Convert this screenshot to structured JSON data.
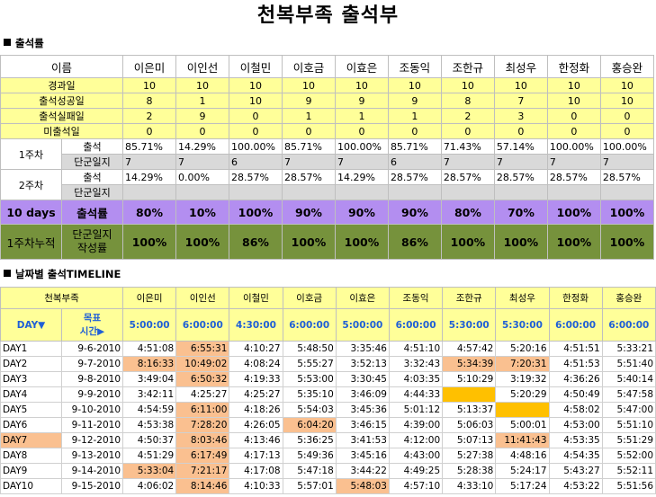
{
  "title": "천복부족 출석부",
  "section1": "출석률",
  "section2": "날짜별 출석TIMELINE",
  "header_label": "이름",
  "names": [
    "이은미",
    "이인선",
    "이철민",
    "이호금",
    "이효은",
    "조동익",
    "조한규",
    "최성우",
    "한정화",
    "홍승완"
  ],
  "summary_rows": [
    {
      "label": "경과일",
      "values": [
        "10",
        "10",
        "10",
        "10",
        "10",
        "10",
        "10",
        "10",
        "10",
        "10"
      ]
    },
    {
      "label": "출석성공일",
      "values": [
        "8",
        "1",
        "10",
        "9",
        "9",
        "9",
        "8",
        "7",
        "10",
        "10"
      ]
    },
    {
      "label": "출석실패일",
      "values": [
        "2",
        "9",
        "0",
        "1",
        "1",
        "1",
        "2",
        "3",
        "0",
        "0"
      ]
    },
    {
      "label": "미출석일",
      "values": [
        "0",
        "0",
        "0",
        "0",
        "0",
        "0",
        "0",
        "0",
        "0",
        "0"
      ]
    }
  ],
  "week1": {
    "label": "1주차",
    "sub1": "출석",
    "sub2": "단군일지",
    "v1": [
      "85.71%",
      "14.29%",
      "100.00%",
      "85.71%",
      "100.00%",
      "85.71%",
      "71.43%",
      "57.14%",
      "100.00%",
      "100.00%"
    ],
    "v2": [
      "7",
      "7",
      "6",
      "7",
      "7",
      "6",
      "7",
      "7",
      "7",
      "7"
    ]
  },
  "week2": {
    "label": "2주차",
    "sub1": "출석",
    "sub2": "단군일지",
    "v1": [
      "14.29%",
      "0.00%",
      "28.57%",
      "28.57%",
      "14.29%",
      "28.57%",
      "28.57%",
      "28.57%",
      "28.57%",
      "28.57%"
    ],
    "v2": [
      "",
      "",
      "",
      "",
      "",
      "",
      "",
      "",
      "",
      ""
    ]
  },
  "tendays": {
    "label": "10 days",
    "sub": "출석률",
    "values": [
      "80%",
      "10%",
      "100%",
      "90%",
      "90%",
      "90%",
      "80%",
      "70%",
      "100%",
      "100%"
    ]
  },
  "cumulative": {
    "label": "1주차누적",
    "sub1": "단군일지",
    "sub2": "작성률",
    "values": [
      "100%",
      "100%",
      "86%",
      "100%",
      "100%",
      "86%",
      "100%",
      "100%",
      "100%",
      "100%"
    ]
  },
  "timeline": {
    "corner": "천복부족",
    "day_label": "DAY▼",
    "goal_label1": "목표",
    "goal_label2": "시간▶",
    "goals": [
      "5:00:00",
      "6:00:00",
      "4:30:00",
      "6:00:00",
      "5:00:00",
      "6:00:00",
      "5:30:00",
      "5:30:00",
      "6:00:00",
      "6:00:00"
    ],
    "rows": [
      {
        "day": "DAY1",
        "date": "9-6-2010",
        "times": [
          "4:51:08",
          "6:55:31",
          "4:10:27",
          "5:48:50",
          "3:35:46",
          "4:51:10",
          "4:57:42",
          "5:20:16",
          "4:51:51",
          "5:33:21"
        ],
        "hl": [
          0,
          1,
          0,
          0,
          0,
          0,
          0,
          0,
          0,
          0
        ]
      },
      {
        "day": "DAY2",
        "date": "9-7-2010",
        "times": [
          "8:16:33",
          "10:49:02",
          "4:08:24",
          "5:55:27",
          "3:52:13",
          "3:32:43",
          "5:34:39",
          "7:20:31",
          "4:51:53",
          "5:51:40"
        ],
        "hl": [
          1,
          1,
          0,
          0,
          0,
          0,
          1,
          1,
          0,
          0
        ]
      },
      {
        "day": "DAY3",
        "date": "9-8-2010",
        "times": [
          "3:49:04",
          "6:50:32",
          "4:19:33",
          "5:53:00",
          "3:30:45",
          "4:03:35",
          "5:10:29",
          "3:19:32",
          "4:36:26",
          "5:40:14"
        ],
        "hl": [
          0,
          1,
          0,
          0,
          0,
          0,
          0,
          0,
          0,
          0
        ]
      },
      {
        "day": "DAY4",
        "date": "9-9-2010",
        "times": [
          "3:42:11",
          "4:25:27",
          "4:25:27",
          "5:35:10",
          "3:46:09",
          "4:44:33",
          "",
          "5:20:29",
          "4:50:49",
          "5:47:58"
        ],
        "hl": [
          0,
          0,
          0,
          0,
          0,
          0,
          2,
          0,
          0,
          0
        ]
      },
      {
        "day": "DAY5",
        "date": "9-10-2010",
        "times": [
          "4:54:59",
          "6:11:00",
          "4:18:26",
          "5:54:03",
          "3:45:36",
          "5:01:12",
          "5:13:37",
          "",
          "4:58:02",
          "5:47:00"
        ],
        "hl": [
          0,
          1,
          0,
          0,
          0,
          0,
          0,
          2,
          0,
          0
        ]
      },
      {
        "day": "DAY6",
        "date": "9-11-2010",
        "times": [
          "4:53:38",
          "7:28:20",
          "4:26:05",
          "6:04:20",
          "3:46:15",
          "4:39:00",
          "5:06:03",
          "5:00:01",
          "4:53:00",
          "5:51:10"
        ],
        "hl": [
          0,
          1,
          0,
          1,
          0,
          0,
          0,
          0,
          0,
          0
        ]
      },
      {
        "day": "DAY7",
        "date": "9-12-2010",
        "times": [
          "4:50:37",
          "8:03:46",
          "4:13:46",
          "5:36:25",
          "3:41:53",
          "4:12:00",
          "5:07:13",
          "11:41:43",
          "4:53:35",
          "5:51:29"
        ],
        "hl": [
          0,
          1,
          0,
          0,
          0,
          0,
          0,
          1,
          0,
          0
        ]
      },
      {
        "day": "DAY8",
        "date": "9-13-2010",
        "times": [
          "4:51:29",
          "6:17:49",
          "4:17:13",
          "5:49:36",
          "3:45:16",
          "4:43:00",
          "5:27:38",
          "4:48:16",
          "4:54:35",
          "5:52:00"
        ],
        "hl": [
          0,
          1,
          0,
          0,
          0,
          0,
          0,
          0,
          0,
          0
        ]
      },
      {
        "day": "DAY9",
        "date": "9-14-2010",
        "times": [
          "5:33:04",
          "7:21:17",
          "4:17:08",
          "5:47:18",
          "3:44:22",
          "4:49:25",
          "5:28:38",
          "5:24:17",
          "5:43:27",
          "5:52:11"
        ],
        "hl": [
          1,
          1,
          0,
          0,
          0,
          0,
          0,
          0,
          0,
          0
        ]
      },
      {
        "day": "DAY10",
        "date": "9-15-2010",
        "times": [
          "4:06:02",
          "8:14:46",
          "4:10:33",
          "5:57:01",
          "5:48:03",
          "4:57:10",
          "4:33:10",
          "5:17:24",
          "4:53:22",
          "5:51:56"
        ],
        "hl": [
          0,
          1,
          0,
          0,
          1,
          0,
          0,
          0,
          0,
          0
        ]
      }
    ],
    "day_highlight": [
      0,
      0,
      0,
      0,
      0,
      0,
      1,
      0,
      0,
      0
    ]
  },
  "colors": {
    "yellow": "#ffff99",
    "gray": "#d9d9d9",
    "purple": "#b38ef0",
    "olive": "#76923c",
    "pink": "#fac090",
    "orange": "#ffc000",
    "blue": "#1f5fd6"
  }
}
